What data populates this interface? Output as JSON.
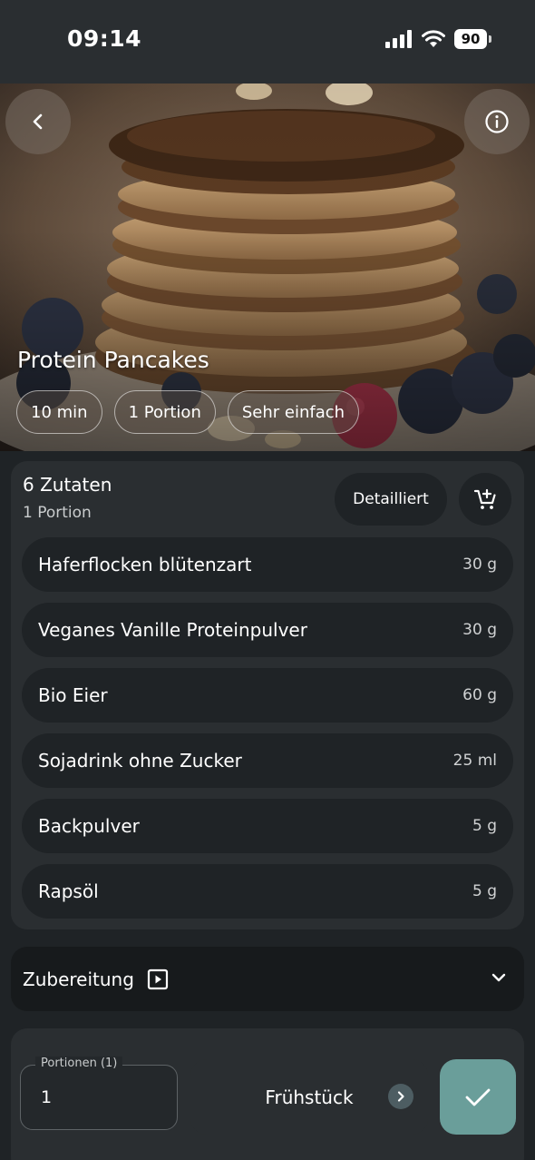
{
  "status_bar": {
    "time": "09:14",
    "battery": "90"
  },
  "recipe": {
    "title": "Protein Pancakes",
    "chips": [
      "10 min",
      "1 Portion",
      "Sehr einfach"
    ]
  },
  "ingredients": {
    "title": "6 Zutaten",
    "subtitle": "1 Portion",
    "detail_label": "Detailliert",
    "items": [
      {
        "name": "Haferflocken blütenzart",
        "amount": "30 g"
      },
      {
        "name": "Veganes Vanille Proteinpulver",
        "amount": "30 g"
      },
      {
        "name": "Bio Eier",
        "amount": "60 g"
      },
      {
        "name": "Sojadrink ohne Zucker",
        "amount": "25 ml"
      },
      {
        "name": "Backpulver",
        "amount": "5 g"
      },
      {
        "name": "Rapsöl",
        "amount": "5 g"
      }
    ]
  },
  "preparation": {
    "label": "Zubereitung"
  },
  "bottom_bar": {
    "portion_label": "Portionen (1)",
    "portion_value": "1",
    "meal_label": "Frühstück"
  },
  "colors": {
    "background": "#1f2326",
    "card": "#2a2e31",
    "accent": "#6a9e9a"
  },
  "icons": {
    "back": "chevron-left-icon",
    "info": "info-icon",
    "cart": "add-to-cart-icon",
    "play": "play-icon",
    "expand": "chevron-down-icon",
    "meal_next": "chevron-right-icon",
    "confirm": "check-icon"
  }
}
